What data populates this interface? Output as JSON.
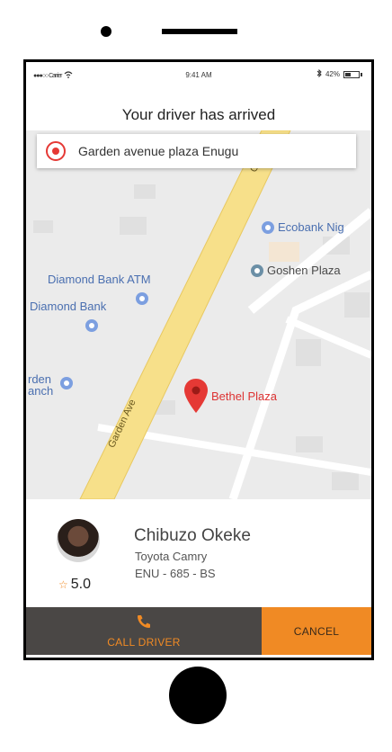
{
  "status_bar": {
    "carrier": "●●●○○ Carrier",
    "time": "9:41 AM",
    "battery_percent": "42%",
    "battery_level": 0.42
  },
  "header": {
    "title": "Your driver has arrived"
  },
  "search": {
    "value": "Garden avenue plaza Enugu"
  },
  "map": {
    "street_label": "Garden Ave",
    "street_label_top": "G",
    "pois": {
      "ecobank": "Ecobank Nig",
      "goshen": "Goshen Plaza",
      "diamond_atm": "Diamond Bank ATM",
      "diamond_bank": "Diamond Bank",
      "garden_branch_1": "rden",
      "garden_branch_2": "anch"
    },
    "destination": "Bethel Plaza"
  },
  "driver": {
    "name": "Chibuzo Okeke",
    "car": "Toyota Camry",
    "plate": "ENU - 685 - BS",
    "rating": "5.0"
  },
  "actions": {
    "call_label": "CALL DRIVER",
    "cancel_label": "CANCEL"
  },
  "colors": {
    "accent": "#f08a24",
    "call_bg": "#4a4745",
    "pin_red": "#e53935"
  },
  "icons": [
    "signal-icon",
    "wifi-icon",
    "bluetooth-icon",
    "battery-icon",
    "location-target-icon",
    "poi-pin-icon",
    "red-map-pin-icon",
    "star-icon",
    "phone-icon"
  ]
}
